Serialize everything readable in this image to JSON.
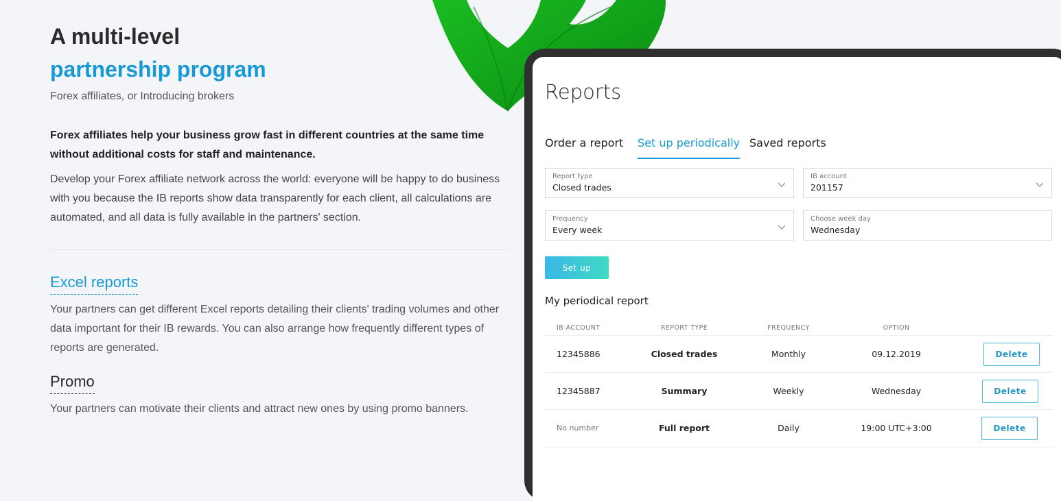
{
  "hero": {
    "title_line1": "A multi-level",
    "title_line2": "partnership program",
    "subtitle": "Forex affiliates, or Introducing brokers",
    "bold_paragraph": "Forex affiliates help your business grow fast in different countries at the same time without additional costs for staff and maintenance.",
    "paragraph": "Develop your Forex affiliate network across the world: everyone will be happy to do business with you because the IB reports show data transparently for each client, all calculations are automated, and all data is fully available in the partners' section."
  },
  "sections": [
    {
      "title": "Excel reports",
      "text": "Your partners can get different Excel reports detailing their clients' trading volumes and other data important for their IB rewards. You can also arrange how frequently different types of reports are generated."
    },
    {
      "title": "Promo",
      "text": "Your partners can motivate their clients and attract new ones by using promo banners."
    }
  ],
  "reports": {
    "title": "Reports",
    "tabs": [
      {
        "label": "Order a report"
      },
      {
        "label": "Set up periodically"
      },
      {
        "label": "Saved reports"
      }
    ],
    "fields": {
      "report_type": {
        "label": "Report type",
        "value": "Closed trades"
      },
      "ib_account": {
        "label": "IB account",
        "value": "201157"
      },
      "frequency": {
        "label": "Frequency",
        "value": "Every week"
      },
      "week_day": {
        "label": "Choose week day",
        "value": "Wednesday"
      }
    },
    "setup_label": "Set up",
    "my_report_title": "My periodical report",
    "columns": [
      "IB ACCOUNT",
      "REPORT TYPE",
      "FREQUENCY",
      "OPTION"
    ],
    "delete_label": "Delete",
    "rows": [
      {
        "account": "12345886",
        "type": "Closed trades",
        "frequency": "Monthly",
        "option": "09.12.2019"
      },
      {
        "account": "12345887",
        "type": "Summary",
        "frequency": "Weekly",
        "option": "Wednesday"
      },
      {
        "account": "No number",
        "type": "Full report",
        "frequency": "Daily",
        "option": "19:00 UTC+3:00"
      }
    ]
  },
  "colors": {
    "accent": "#179ad6",
    "tablet_frame": "#2f2f2f",
    "leaf": "#12a01a",
    "button_gradient_start": "#39b8e6",
    "button_gradient_end": "#3fdac4"
  },
  "icons": [
    "monstera-leaf-icon",
    "chevron-down-icon"
  ]
}
